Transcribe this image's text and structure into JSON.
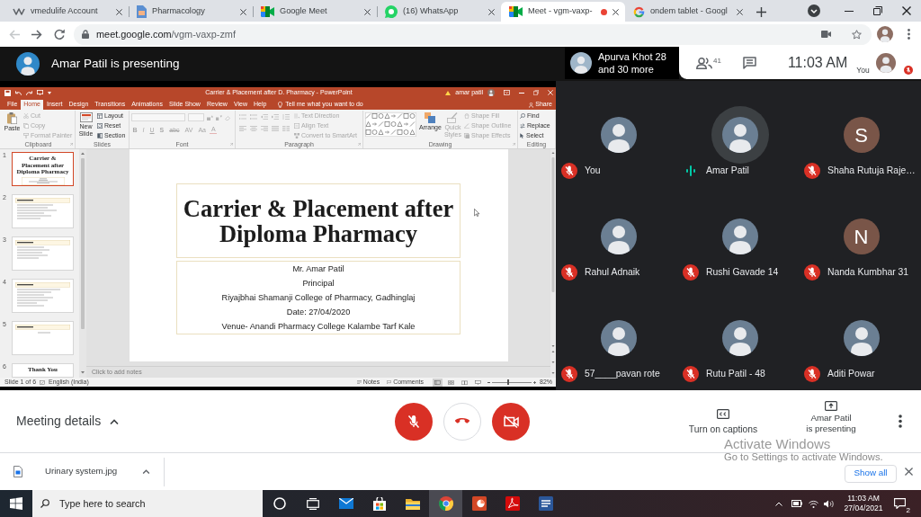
{
  "browser": {
    "tabs": [
      {
        "title": "vmedulife Account",
        "kind": "wave",
        "selected": false,
        "recording": false
      },
      {
        "title": "Pharmacology",
        "kind": "document",
        "selected": false,
        "recording": false
      },
      {
        "title": "Google Meet",
        "kind": "camera",
        "selected": false,
        "recording": false
      },
      {
        "title": "(16) WhatsApp",
        "kind": "chat",
        "selected": false,
        "recording": false
      },
      {
        "title": "Meet - vgm-vaxp-",
        "kind": "camera",
        "selected": true,
        "recording": true
      },
      {
        "title": "ondem tablet - Googl",
        "kind": "letter-g",
        "selected": false,
        "recording": false
      }
    ],
    "back_disabled": true,
    "address": {
      "host": "meet.google.com",
      "path": "/vgm-vaxp-zmf"
    }
  },
  "meet": {
    "banner": "Amar Patil is presenting",
    "others": {
      "name": "Apurva Khot 28",
      "more": "and 30 more"
    },
    "people_count": "41",
    "time": "11:03 AM",
    "self_label": "You",
    "self_muted": true
  },
  "powerpoint": {
    "title": "Carrier & Placement after D. Pharmacy - PowerPoint",
    "user": "amar patil",
    "tabs": [
      {
        "label": "File",
        "selected": false
      },
      {
        "label": "Home",
        "selected": true
      },
      {
        "label": "Insert",
        "selected": false
      },
      {
        "label": "Design",
        "selected": false
      },
      {
        "label": "Transitions",
        "selected": false
      },
      {
        "label": "Animations",
        "selected": false
      },
      {
        "label": "Slide Show",
        "selected": false
      },
      {
        "label": "Review",
        "selected": false
      },
      {
        "label": "View",
        "selected": false
      },
      {
        "label": "Help",
        "selected": false
      }
    ],
    "tell_me": "Tell me what you want to do",
    "share": "Share",
    "ribbon": [
      {
        "label": "Clipboard",
        "kind": "clipboard",
        "items": [
          {
            "label": "Paste",
            "disabled": false
          },
          {
            "label": "Cut",
            "disabled": true
          },
          {
            "label": "Copy",
            "disabled": true
          },
          {
            "label": "Format Painter",
            "disabled": true
          }
        ]
      },
      {
        "label": "Slides",
        "kind": "slides",
        "items": [
          {
            "label": "New Slide",
            "disabled": false
          },
          {
            "label": "Layout",
            "disabled": false
          },
          {
            "label": "Reset",
            "disabled": false
          },
          {
            "label": "Section",
            "disabled": false
          }
        ]
      },
      {
        "label": "Font",
        "kind": "font",
        "items": [
          {
            "label": "B",
            "kind": "bold",
            "disabled": true
          },
          {
            "label": "I",
            "kind": "italic",
            "disabled": true
          },
          {
            "label": "U",
            "kind": "underline",
            "disabled": true
          },
          {
            "label": "S",
            "kind": "shadow",
            "disabled": true
          },
          {
            "label": "abc",
            "kind": "strike",
            "disabled": true
          },
          {
            "label": "AV",
            "kind": "spacing",
            "disabled": true
          },
          {
            "label": "Aa",
            "kind": "case",
            "disabled": true
          },
          {
            "label": "A",
            "kind": "color",
            "disabled": true
          }
        ]
      },
      {
        "label": "Paragraph",
        "kind": "paragraph",
        "items": [
          {
            "label": "Text Direction",
            "disabled": true
          },
          {
            "label": "Align Text",
            "disabled": true
          },
          {
            "label": "Convert to SmartArt",
            "disabled": true
          }
        ]
      },
      {
        "label": "Drawing",
        "kind": "drawing",
        "items": [
          {
            "label": "Arrange",
            "disabled": false
          },
          {
            "label": "Quick Styles",
            "disabled": true
          },
          {
            "label": "Shape Fill",
            "disabled": true
          },
          {
            "label": "Shape Outline",
            "disabled": true
          },
          {
            "label": "Shape Effects",
            "disabled": true
          }
        ]
      },
      {
        "label": "Editing",
        "kind": "editing",
        "items": [
          {
            "label": "Find",
            "disabled": false
          },
          {
            "label": "Replace",
            "disabled": false
          },
          {
            "label": "Select",
            "disabled": false
          }
        ]
      }
    ],
    "thumbnails": [
      {
        "number": "1",
        "selected": true,
        "title": "Carrier & Placement after Diploma Pharmacy"
      },
      {
        "number": "2",
        "selected": false
      },
      {
        "number": "3",
        "selected": false
      },
      {
        "number": "4",
        "selected": false
      },
      {
        "number": "5",
        "selected": false
      },
      {
        "number": "6",
        "selected": false,
        "title": "Thank You"
      }
    ],
    "slide": {
      "title": "Carrier & Placement after Diploma Pharmacy",
      "lines": [
        "Mr. Amar Patil",
        "Principal",
        "Riyajbhai Shamanji College of Pharmacy, Gadhinglaj",
        "Date: 27/04/2020",
        "Venue- Anandi Pharmacy College Kalambe Tarf Kale"
      ]
    },
    "notes_placeholder": "Click to add notes",
    "status": {
      "slide": "Slide 1 of 6",
      "language": "English (India)",
      "notes": "Notes",
      "comments": "Comments",
      "views": [
        {
          "kind": "normal",
          "selected": true
        },
        {
          "kind": "sorter",
          "selected": false
        },
        {
          "kind": "reading",
          "selected": false
        },
        {
          "kind": "show",
          "selected": false
        }
      ],
      "zoom": {
        "reading": "82%",
        "level": 0.42
      }
    }
  },
  "participants": [
    {
      "name": "You",
      "kind": "photo",
      "muted": true,
      "speaking": false
    },
    {
      "name": "Amar Patil",
      "kind": "photo",
      "muted": false,
      "speaking": true
    },
    {
      "name": "Shaha Rutuja Raje…",
      "kind": "initial",
      "initial": "S",
      "muted": true,
      "speaking": false
    },
    {
      "name": "Rahul Adnaik",
      "kind": "photo",
      "muted": true,
      "speaking": false
    },
    {
      "name": "Rushi Gavade 14",
      "kind": "photo",
      "muted": true,
      "speaking": false
    },
    {
      "name": "Nanda Kumbhar 31",
      "kind": "initial",
      "initial": "N",
      "muted": true,
      "speaking": false
    },
    {
      "name": "57____pavan rote",
      "kind": "photo",
      "muted": true,
      "speaking": false
    },
    {
      "name": "Rutu Patil - 48",
      "kind": "photo",
      "muted": true,
      "speaking": false
    },
    {
      "name": "Aditi Powar",
      "kind": "photo",
      "muted": true,
      "speaking": false
    }
  ],
  "call_bar": {
    "details": "Meeting details",
    "mic_on": false,
    "camera_on": false,
    "captions": "Turn on captions",
    "presenting": [
      "Amar Patil",
      "is presenting"
    ]
  },
  "downloads": {
    "files": [
      {
        "name": "Urinary system.jpg"
      }
    ],
    "show_all": "Show all"
  },
  "windows_notice": {
    "title": "Activate Windows",
    "text": "Go to Settings to activate Windows."
  },
  "taskbar": {
    "search_placeholder": "Type here to search",
    "apps": [
      {
        "kind": "cortana",
        "selected": false
      },
      {
        "kind": "task-view",
        "selected": false
      },
      {
        "kind": "mail",
        "selected": false
      },
      {
        "kind": "store",
        "selected": false
      },
      {
        "kind": "folder",
        "selected": false
      },
      {
        "kind": "chrome",
        "selected": true
      },
      {
        "kind": "powerpoint",
        "selected": false
      },
      {
        "kind": "acrobat",
        "selected": false
      },
      {
        "kind": "word",
        "selected": false
      }
    ],
    "time": "11:03 AM",
    "date": "27/04/2021",
    "notifications": "2"
  }
}
